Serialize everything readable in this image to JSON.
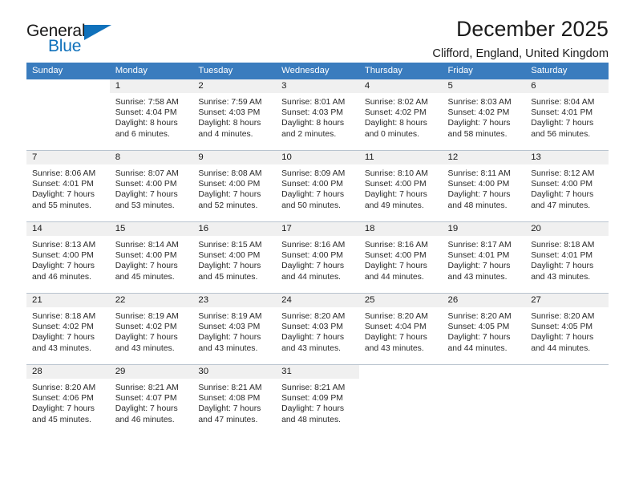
{
  "brand": {
    "name_part1": "General",
    "name_part2": "Blue",
    "triangle_icon": "triangle-icon",
    "accent_color": "#1071bb"
  },
  "header": {
    "title": "December 2025",
    "subtitle": "Clifford, England, United Kingdom"
  },
  "calendar": {
    "header_bg": "#3a7cbe",
    "daynum_bg": "#f0f0f0",
    "weekday_headers": [
      "Sunday",
      "Monday",
      "Tuesday",
      "Wednesday",
      "Thursday",
      "Friday",
      "Saturday"
    ],
    "labels": {
      "sunrise_prefix": "Sunrise:",
      "sunset_prefix": "Sunset:",
      "daylight_prefix": "Daylight:"
    },
    "weeks": [
      [
        {
          "day": "",
          "blank": true
        },
        {
          "day": "1",
          "sunrise": "Sunrise: 7:58 AM",
          "sunset": "Sunset: 4:04 PM",
          "daylight_line1": "Daylight: 8 hours",
          "daylight_line2": "and 6 minutes."
        },
        {
          "day": "2",
          "sunrise": "Sunrise: 7:59 AM",
          "sunset": "Sunset: 4:03 PM",
          "daylight_line1": "Daylight: 8 hours",
          "daylight_line2": "and 4 minutes."
        },
        {
          "day": "3",
          "sunrise": "Sunrise: 8:01 AM",
          "sunset": "Sunset: 4:03 PM",
          "daylight_line1": "Daylight: 8 hours",
          "daylight_line2": "and 2 minutes."
        },
        {
          "day": "4",
          "sunrise": "Sunrise: 8:02 AM",
          "sunset": "Sunset: 4:02 PM",
          "daylight_line1": "Daylight: 8 hours",
          "daylight_line2": "and 0 minutes."
        },
        {
          "day": "5",
          "sunrise": "Sunrise: 8:03 AM",
          "sunset": "Sunset: 4:02 PM",
          "daylight_line1": "Daylight: 7 hours",
          "daylight_line2": "and 58 minutes."
        },
        {
          "day": "6",
          "sunrise": "Sunrise: 8:04 AM",
          "sunset": "Sunset: 4:01 PM",
          "daylight_line1": "Daylight: 7 hours",
          "daylight_line2": "and 56 minutes."
        }
      ],
      [
        {
          "day": "7",
          "sunrise": "Sunrise: 8:06 AM",
          "sunset": "Sunset: 4:01 PM",
          "daylight_line1": "Daylight: 7 hours",
          "daylight_line2": "and 55 minutes."
        },
        {
          "day": "8",
          "sunrise": "Sunrise: 8:07 AM",
          "sunset": "Sunset: 4:00 PM",
          "daylight_line1": "Daylight: 7 hours",
          "daylight_line2": "and 53 minutes."
        },
        {
          "day": "9",
          "sunrise": "Sunrise: 8:08 AM",
          "sunset": "Sunset: 4:00 PM",
          "daylight_line1": "Daylight: 7 hours",
          "daylight_line2": "and 52 minutes."
        },
        {
          "day": "10",
          "sunrise": "Sunrise: 8:09 AM",
          "sunset": "Sunset: 4:00 PM",
          "daylight_line1": "Daylight: 7 hours",
          "daylight_line2": "and 50 minutes."
        },
        {
          "day": "11",
          "sunrise": "Sunrise: 8:10 AM",
          "sunset": "Sunset: 4:00 PM",
          "daylight_line1": "Daylight: 7 hours",
          "daylight_line2": "and 49 minutes."
        },
        {
          "day": "12",
          "sunrise": "Sunrise: 8:11 AM",
          "sunset": "Sunset: 4:00 PM",
          "daylight_line1": "Daylight: 7 hours",
          "daylight_line2": "and 48 minutes."
        },
        {
          "day": "13",
          "sunrise": "Sunrise: 8:12 AM",
          "sunset": "Sunset: 4:00 PM",
          "daylight_line1": "Daylight: 7 hours",
          "daylight_line2": "and 47 minutes."
        }
      ],
      [
        {
          "day": "14",
          "sunrise": "Sunrise: 8:13 AM",
          "sunset": "Sunset: 4:00 PM",
          "daylight_line1": "Daylight: 7 hours",
          "daylight_line2": "and 46 minutes."
        },
        {
          "day": "15",
          "sunrise": "Sunrise: 8:14 AM",
          "sunset": "Sunset: 4:00 PM",
          "daylight_line1": "Daylight: 7 hours",
          "daylight_line2": "and 45 minutes."
        },
        {
          "day": "16",
          "sunrise": "Sunrise: 8:15 AM",
          "sunset": "Sunset: 4:00 PM",
          "daylight_line1": "Daylight: 7 hours",
          "daylight_line2": "and 45 minutes."
        },
        {
          "day": "17",
          "sunrise": "Sunrise: 8:16 AM",
          "sunset": "Sunset: 4:00 PM",
          "daylight_line1": "Daylight: 7 hours",
          "daylight_line2": "and 44 minutes."
        },
        {
          "day": "18",
          "sunrise": "Sunrise: 8:16 AM",
          "sunset": "Sunset: 4:00 PM",
          "daylight_line1": "Daylight: 7 hours",
          "daylight_line2": "and 44 minutes."
        },
        {
          "day": "19",
          "sunrise": "Sunrise: 8:17 AM",
          "sunset": "Sunset: 4:01 PM",
          "daylight_line1": "Daylight: 7 hours",
          "daylight_line2": "and 43 minutes."
        },
        {
          "day": "20",
          "sunrise": "Sunrise: 8:18 AM",
          "sunset": "Sunset: 4:01 PM",
          "daylight_line1": "Daylight: 7 hours",
          "daylight_line2": "and 43 minutes."
        }
      ],
      [
        {
          "day": "21",
          "sunrise": "Sunrise: 8:18 AM",
          "sunset": "Sunset: 4:02 PM",
          "daylight_line1": "Daylight: 7 hours",
          "daylight_line2": "and 43 minutes."
        },
        {
          "day": "22",
          "sunrise": "Sunrise: 8:19 AM",
          "sunset": "Sunset: 4:02 PM",
          "daylight_line1": "Daylight: 7 hours",
          "daylight_line2": "and 43 minutes."
        },
        {
          "day": "23",
          "sunrise": "Sunrise: 8:19 AM",
          "sunset": "Sunset: 4:03 PM",
          "daylight_line1": "Daylight: 7 hours",
          "daylight_line2": "and 43 minutes."
        },
        {
          "day": "24",
          "sunrise": "Sunrise: 8:20 AM",
          "sunset": "Sunset: 4:03 PM",
          "daylight_line1": "Daylight: 7 hours",
          "daylight_line2": "and 43 minutes."
        },
        {
          "day": "25",
          "sunrise": "Sunrise: 8:20 AM",
          "sunset": "Sunset: 4:04 PM",
          "daylight_line1": "Daylight: 7 hours",
          "daylight_line2": "and 43 minutes."
        },
        {
          "day": "26",
          "sunrise": "Sunrise: 8:20 AM",
          "sunset": "Sunset: 4:05 PM",
          "daylight_line1": "Daylight: 7 hours",
          "daylight_line2": "and 44 minutes."
        },
        {
          "day": "27",
          "sunrise": "Sunrise: 8:20 AM",
          "sunset": "Sunset: 4:05 PM",
          "daylight_line1": "Daylight: 7 hours",
          "daylight_line2": "and 44 minutes."
        }
      ],
      [
        {
          "day": "28",
          "sunrise": "Sunrise: 8:20 AM",
          "sunset": "Sunset: 4:06 PM",
          "daylight_line1": "Daylight: 7 hours",
          "daylight_line2": "and 45 minutes."
        },
        {
          "day": "29",
          "sunrise": "Sunrise: 8:21 AM",
          "sunset": "Sunset: 4:07 PM",
          "daylight_line1": "Daylight: 7 hours",
          "daylight_line2": "and 46 minutes."
        },
        {
          "day": "30",
          "sunrise": "Sunrise: 8:21 AM",
          "sunset": "Sunset: 4:08 PM",
          "daylight_line1": "Daylight: 7 hours",
          "daylight_line2": "and 47 minutes."
        },
        {
          "day": "31",
          "sunrise": "Sunrise: 8:21 AM",
          "sunset": "Sunset: 4:09 PM",
          "daylight_line1": "Daylight: 7 hours",
          "daylight_line2": "and 48 minutes."
        },
        {
          "day": "",
          "blank": true
        },
        {
          "day": "",
          "blank": true
        },
        {
          "day": "",
          "blank": true
        }
      ]
    ]
  }
}
